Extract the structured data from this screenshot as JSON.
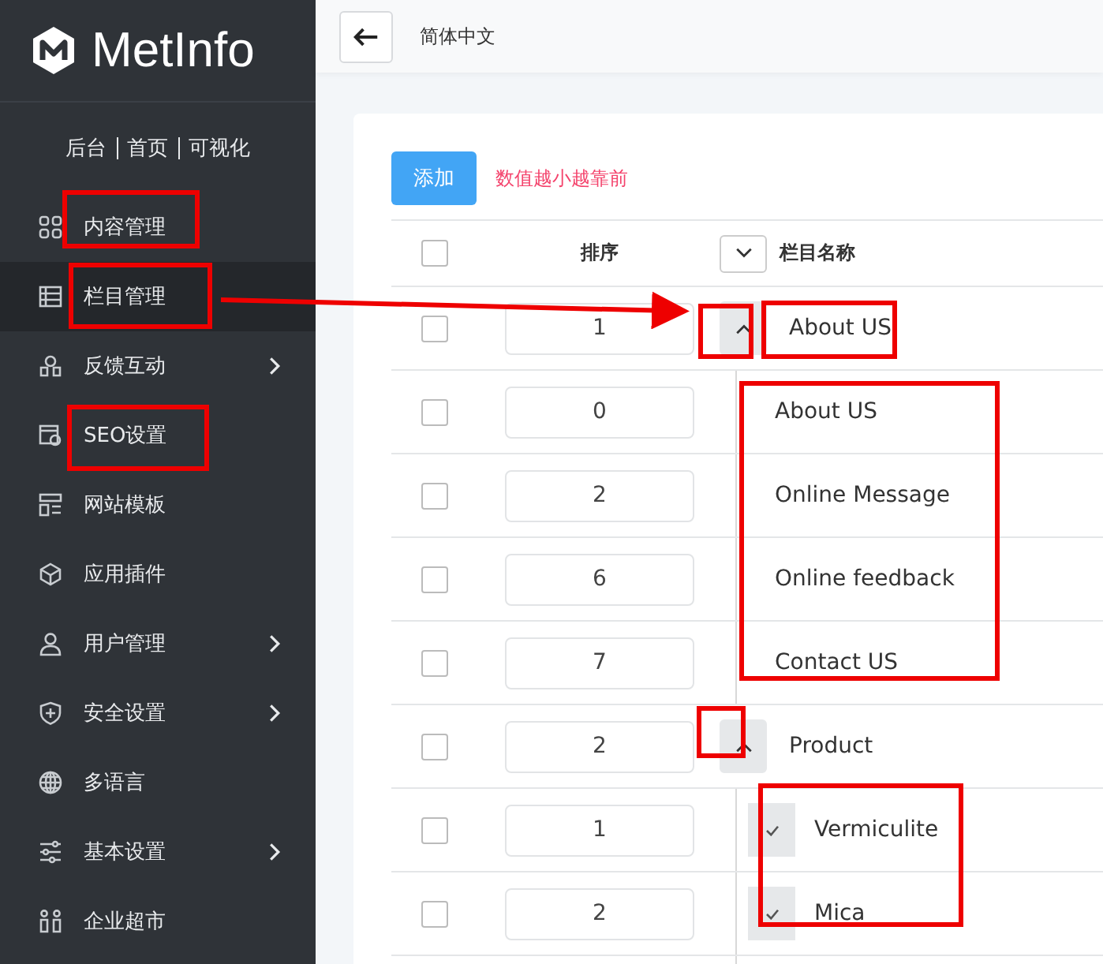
{
  "sidebar": {
    "logo": "MetInfo",
    "links": [
      "后台",
      "首页",
      "可视化"
    ],
    "items": [
      {
        "label": "内容管理",
        "selected": false,
        "has_submenu": false
      },
      {
        "label": "栏目管理",
        "selected": true,
        "has_submenu": false
      },
      {
        "label": "反馈互动",
        "selected": false,
        "has_submenu": true
      },
      {
        "label": "SEO设置",
        "selected": false,
        "has_submenu": false
      },
      {
        "label": "网站模板",
        "selected": false,
        "has_submenu": false
      },
      {
        "label": "应用插件",
        "selected": false,
        "has_submenu": false
      },
      {
        "label": "用户管理",
        "selected": false,
        "has_submenu": true
      },
      {
        "label": "安全设置",
        "selected": false,
        "has_submenu": true
      },
      {
        "label": "多语言",
        "selected": false,
        "has_submenu": false
      },
      {
        "label": "基本设置",
        "selected": false,
        "has_submenu": true
      },
      {
        "label": "企业超市",
        "selected": false,
        "has_submenu": false
      }
    ]
  },
  "topbar": {
    "language": "简体中文"
  },
  "toolbar": {
    "add_button": "添加",
    "hint": "数值越小越靠前"
  },
  "table": {
    "all_checked": false,
    "columns": [
      "排序",
      "栏目名称"
    ],
    "rows": [
      {
        "order": "1",
        "name": "About US",
        "checked": false,
        "expanded": true,
        "children": [
          {
            "order": "0",
            "name": "About US",
            "checked": false
          },
          {
            "order": "2",
            "name": "Online Message",
            "checked": false
          },
          {
            "order": "6",
            "name": "Online feedback",
            "checked": false
          },
          {
            "order": "7",
            "name": "Contact US",
            "checked": false
          }
        ]
      },
      {
        "order": "2",
        "name": "Product",
        "checked": false,
        "expanded": true,
        "children": [
          {
            "order": "1",
            "name": "Vermiculite",
            "checked": false,
            "kind": "check"
          },
          {
            "order": "2",
            "name": "Mica",
            "checked": false,
            "kind": "check"
          }
        ]
      }
    ]
  }
}
